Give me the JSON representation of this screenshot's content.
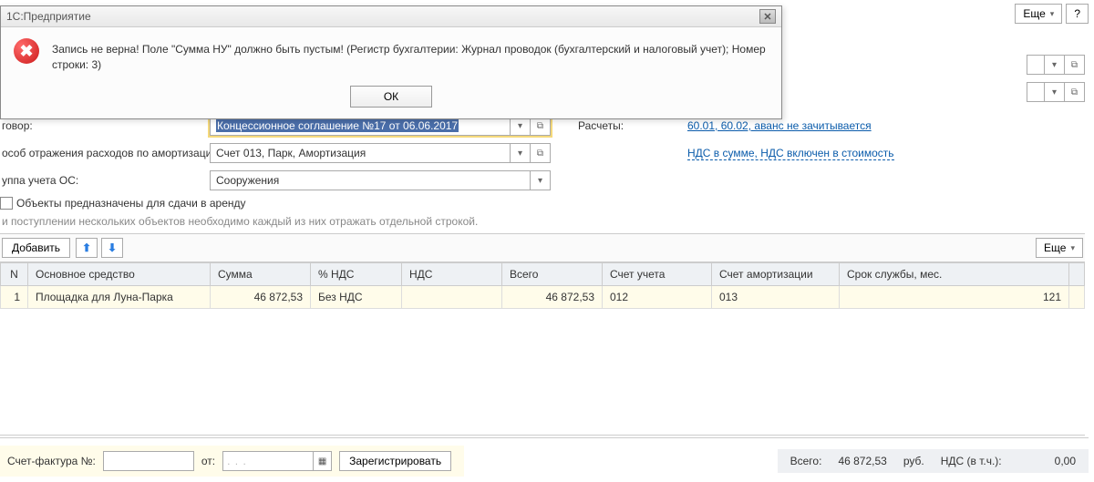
{
  "topButtons": {
    "more": "Еще",
    "help": "?"
  },
  "modal": {
    "title": "1С:Предприятие",
    "message": "Запись не верна! Поле \"Сумма НУ\" должно быть пустым! (Регистр бухгалтерии: Журнал проводок (бухгалтерский и налоговый учет); Номер строки: 3)",
    "ok": "ОК"
  },
  "form": {
    "row_contract_label": "говор:",
    "row_contract_value": "Концессионное соглашение №17 от 06.06.2017",
    "row_calc_label": "Расчеты:",
    "row_calc_link": "60.01, 60.02, аванс не зачитывается",
    "row_amort_label": "особ отражения расходов по амортизации:",
    "row_amort_value": "Счет 013, Парк, Амортизация",
    "row_vat_link": "НДС в сумме, НДС включен в стоимость",
    "row_group_label": "уппа учета ОС:",
    "row_group_value": "Сооружения",
    "checkbox_label": "Объекты предназначены для сдачи в аренду",
    "hint": "и поступлении нескольких объектов необходимо каждый из них отражать отдельной строкой."
  },
  "toolbar": {
    "add": "Добавить",
    "more": "Еще"
  },
  "table": {
    "headers": {
      "n": "N",
      "asset": "Основное средство",
      "sum": "Сумма",
      "vat_pct": "% НДС",
      "vat": "НДС",
      "total": "Всего",
      "acc": "Счет учета",
      "amort_acc": "Счет амортизации",
      "term": "Срок службы, мес."
    },
    "row": {
      "n": "1",
      "asset": "Площадка для Луна-Парка",
      "sum": "46 872,53",
      "vat_pct": "Без НДС",
      "vat": "",
      "total": "46 872,53",
      "acc": "012",
      "amort_acc": "013",
      "term": "121"
    }
  },
  "footer": {
    "invoice_label": "Счет-фактура №:",
    "from": "от:",
    "date_placeholder": ". . .",
    "register": "Зарегистрировать",
    "total_label": "Всего:",
    "total_value": "46 872,53",
    "currency": "руб.",
    "vat_label": "НДС (в т.ч.):",
    "vat_value": "0,00"
  }
}
